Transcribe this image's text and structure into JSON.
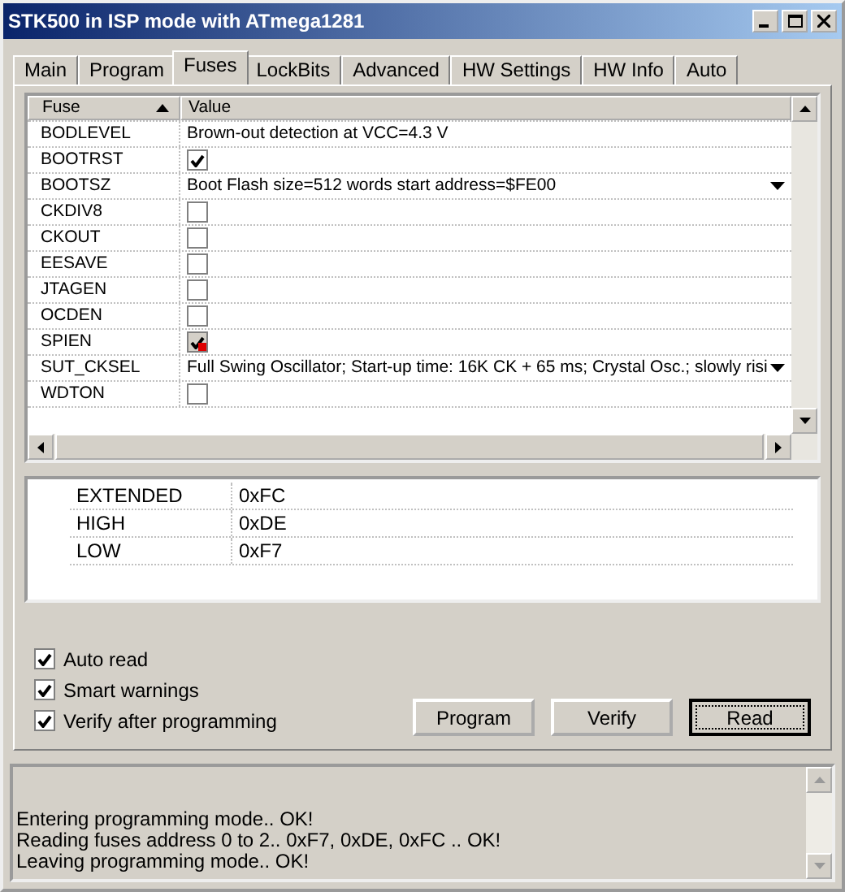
{
  "window": {
    "title": "STK500 in ISP mode with ATmega1281"
  },
  "tabs": [
    {
      "label": "Main",
      "selected": false
    },
    {
      "label": "Program",
      "selected": false
    },
    {
      "label": "Fuses",
      "selected": true
    },
    {
      "label": "LockBits",
      "selected": false
    },
    {
      "label": "Advanced",
      "selected": false
    },
    {
      "label": "HW Settings",
      "selected": false
    },
    {
      "label": "HW Info",
      "selected": false
    },
    {
      "label": "Auto",
      "selected": false
    }
  ],
  "fuse_table": {
    "columns": [
      "Fuse",
      "Value"
    ],
    "rows": [
      {
        "name": "BODLEVEL",
        "kind": "text",
        "value": "Brown-out detection at VCC=4.3 V"
      },
      {
        "name": "BOOTRST",
        "kind": "check",
        "checked": true
      },
      {
        "name": "BOOTSZ",
        "kind": "select",
        "value": "Boot Flash size=512 words start address=$FE00"
      },
      {
        "name": "CKDIV8",
        "kind": "check",
        "checked": false
      },
      {
        "name": "CKOUT",
        "kind": "check",
        "checked": false
      },
      {
        "name": "EESAVE",
        "kind": "check",
        "checked": false
      },
      {
        "name": "JTAGEN",
        "kind": "check",
        "checked": false
      },
      {
        "name": "OCDEN",
        "kind": "check",
        "checked": false
      },
      {
        "name": "SPIEN",
        "kind": "check",
        "checked": true,
        "locked": true
      },
      {
        "name": "SUT_CKSEL",
        "kind": "select",
        "value": "Full Swing Oscillator; Start-up time: 16K CK + 65 ms; Crystal Osc.; slowly risi"
      },
      {
        "name": "WDTON",
        "kind": "check",
        "checked": false
      }
    ]
  },
  "registers": [
    {
      "name": "EXTENDED",
      "value": "0xFC"
    },
    {
      "name": "HIGH",
      "value": "0xDE"
    },
    {
      "name": "LOW",
      "value": "0xF7"
    }
  ],
  "options": [
    {
      "label": "Auto read",
      "checked": true
    },
    {
      "label": "Smart warnings",
      "checked": true
    },
    {
      "label": "Verify after programming",
      "checked": true
    }
  ],
  "buttons": [
    {
      "label": "Program",
      "focused": false
    },
    {
      "label": "Verify",
      "focused": false
    },
    {
      "label": "Read",
      "focused": true
    }
  ],
  "log": [
    "Entering programming mode.. OK!",
    "Reading fuses address 0 to 2.. 0xF7, 0xDE, 0xFC .. OK!",
    "Leaving programming mode.. OK!"
  ]
}
